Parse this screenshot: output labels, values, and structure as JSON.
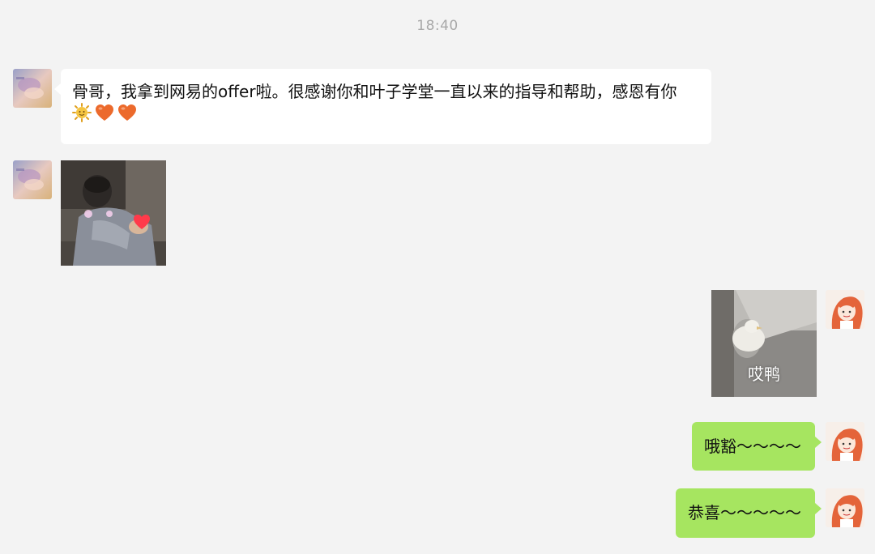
{
  "chat": {
    "timestamp": "18:40",
    "messages": [
      {
        "sender": "other",
        "type": "text",
        "text": "骨哥，我拿到网易的offer啦。很感谢你和叶子学堂一直以来的指导和帮助，感恩有你",
        "emojis": [
          "sun-emoji",
          "heart-emoji",
          "heart-emoji"
        ]
      },
      {
        "sender": "other",
        "type": "sticker",
        "sticker": "man-clutching-heart-sticker"
      },
      {
        "sender": "self",
        "type": "sticker",
        "sticker": "duck-sticker",
        "caption": "哎鸭"
      },
      {
        "sender": "self",
        "type": "text",
        "text": "哦豁～～～～"
      },
      {
        "sender": "self",
        "type": "text",
        "text": "恭喜～～～～～"
      }
    ]
  },
  "colors": {
    "background": "#f3f3f3",
    "bubble_other": "#ffffff",
    "bubble_self": "#a6e560",
    "timestamp_text": "#a8a8a8"
  }
}
